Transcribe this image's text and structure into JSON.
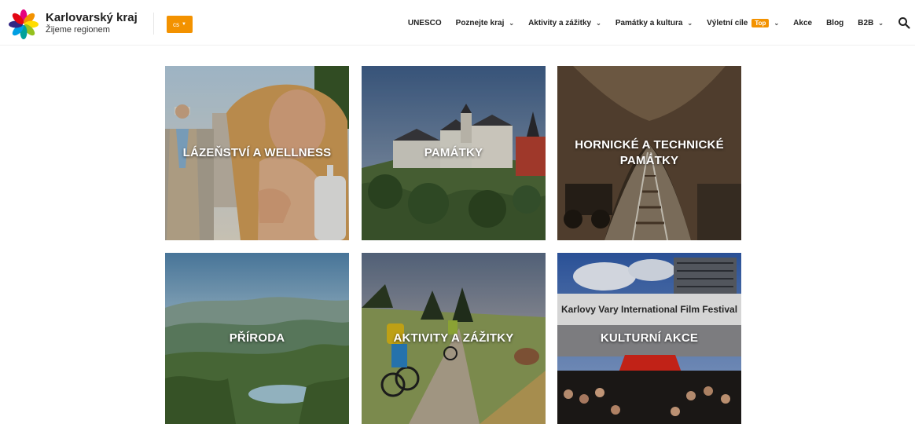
{
  "brand": {
    "name": "Karlovarský kraj",
    "tagline": "Žijeme regionem"
  },
  "language": {
    "selected": "cs"
  },
  "nav": {
    "items": [
      {
        "label": "UNESCO"
      },
      {
        "label": "Poznejte kraj"
      },
      {
        "label": "Aktivity a zážitky"
      },
      {
        "label": "Památky a kultura"
      },
      {
        "label": "Výletní cíle",
        "badge": "Top"
      },
      {
        "label": "Akce"
      },
      {
        "label": "Blog"
      },
      {
        "label": "B2B"
      }
    ]
  },
  "tiles": [
    {
      "label": "LÁZEŇSTVÍ A WELLNESS"
    },
    {
      "label": "PAMÁTKY"
    },
    {
      "label": "HORNICKÉ A TECHNICKÉ PAMÁTKY"
    },
    {
      "label": "PŘÍRODA"
    },
    {
      "label": "AKTIVITY A ZÁŽITKY"
    },
    {
      "label": "KULTURNÍ AKCE"
    }
  ],
  "images": {
    "festival_sign": "Karlovy Vary International Film Festival"
  },
  "colors": {
    "accent": "#f39200"
  }
}
